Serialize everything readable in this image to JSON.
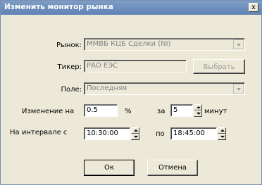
{
  "window": {
    "title": "Изменить монитор рынка",
    "close_glyph": "x"
  },
  "market": {
    "label": "Рынок:",
    "value": "ММВБ КЦБ Сделки (NI)"
  },
  "ticker": {
    "label": "Тикер:",
    "value": "РАО ЕЭС",
    "select_label": "Выбрать"
  },
  "field": {
    "label": "Поле:",
    "value": "Последняя"
  },
  "change": {
    "label": "Изменение на",
    "value": "0.5",
    "unit": "%",
    "for_label": "за",
    "minutes_value": "5",
    "minutes_label": "минут"
  },
  "interval": {
    "label": "На интервале с",
    "from_value": "10:30:00",
    "to_label": "по",
    "to_value": "18:45:00"
  },
  "buttons": {
    "ok": "Ок",
    "cancel": "Отмена"
  }
}
